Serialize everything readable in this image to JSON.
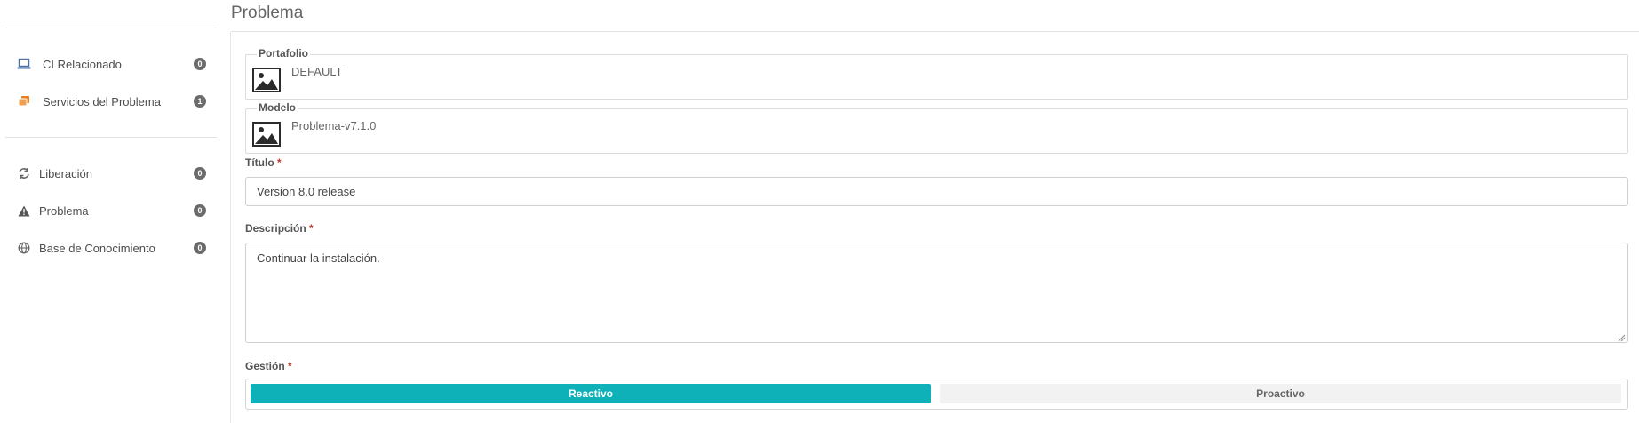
{
  "sidebar": {
    "items": [
      {
        "label": "CI Relacionado",
        "count": "0",
        "icon": "laptop-icon",
        "color": "#4a6fa5"
      },
      {
        "label": "Servicios del Problema",
        "count": "1",
        "icon": "services-icon",
        "color": "#e67e22"
      },
      {
        "label": "Liberación",
        "count": "0",
        "icon": "refresh-icon",
        "color": "#666666"
      },
      {
        "label": "Problema",
        "count": "0",
        "icon": "warning-icon",
        "color": "#555555"
      },
      {
        "label": "Base de Conocimiento",
        "count": "0",
        "icon": "globe-icon",
        "color": "#666666"
      }
    ]
  },
  "page": {
    "title": "Problema"
  },
  "form": {
    "portfolio": {
      "legend": "Portafolio",
      "value": "DEFAULT",
      "icon": "image-icon"
    },
    "model": {
      "legend": "Modelo",
      "value": "Problema-v7.1.0",
      "icon": "image-icon"
    },
    "title": {
      "label": "Título",
      "required": "*",
      "value": "Version 8.0 release"
    },
    "description": {
      "label": "Descripción",
      "required": "*",
      "value": "Continuar la instalación."
    },
    "management": {
      "label": "Gestión",
      "required": "*",
      "options": [
        "Reactivo",
        "Proactivo"
      ],
      "selected": "Reactivo"
    }
  },
  "colors": {
    "accent": "#0fb1b8",
    "required": "#c0392b"
  }
}
